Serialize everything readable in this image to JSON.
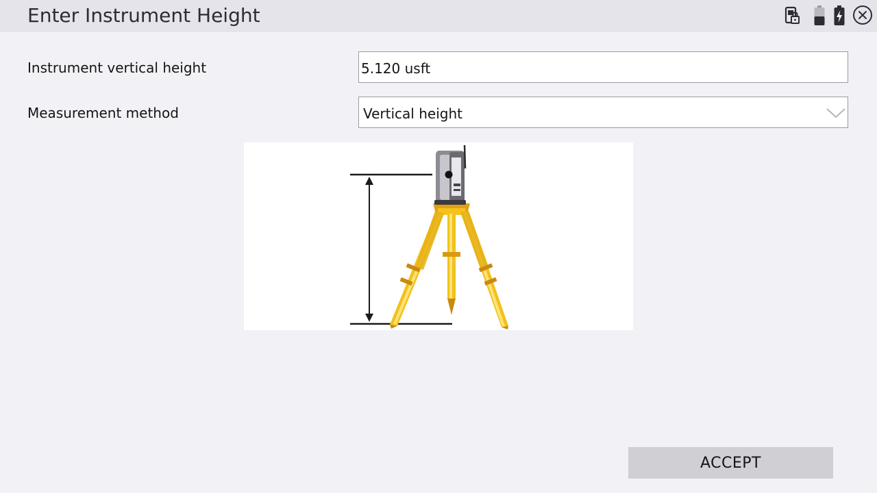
{
  "window": {
    "title": "Enter Instrument Height",
    "icons": [
      "controller-lock-icon",
      "battery-low-icon",
      "battery-charging-icon",
      "close-icon"
    ]
  },
  "form": {
    "instrument_height": {
      "label": "Instrument vertical height",
      "value": "5.120 usft"
    },
    "measurement_method": {
      "label": "Measurement method",
      "value": "Vertical height"
    }
  },
  "figure": {
    "icon": "total-station-tripod-vertical-height-diagram"
  },
  "actions": {
    "accept_label": "ACCEPT"
  },
  "colors": {
    "titlebar": "#e4e4ea",
    "background": "#f2f2f6",
    "tripod": "#f2c21b",
    "button": "#cfcfd4"
  }
}
